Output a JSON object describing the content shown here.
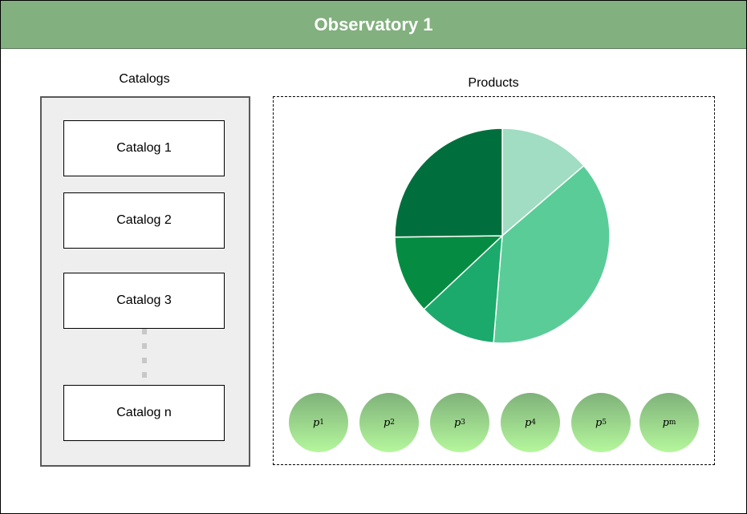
{
  "title": "Observatory 1",
  "colors": {
    "header": "#82b07e",
    "panel_bg": "#eeeeee",
    "product_top": "#7fb27a",
    "product_bottom": "#b5f79c"
  },
  "catalogs": {
    "label": "Catalogs",
    "items": [
      "Catalog 1",
      "Catalog 2",
      "Catalog 3",
      "Catalog n"
    ]
  },
  "products": {
    "label": "Products",
    "chart_data": {
      "type": "pie",
      "slices": [
        {
          "value": 0.137,
          "color": "#a0ddc2"
        },
        {
          "value": 0.376,
          "color": "#5acc98"
        },
        {
          "value": 0.117,
          "color": "#1baa6c"
        },
        {
          "value": 0.118,
          "color": "#068c42"
        },
        {
          "value": 0.252,
          "color": "#016f3d"
        }
      ]
    },
    "items": [
      {
        "symbol": "p",
        "sub": "1"
      },
      {
        "symbol": "p",
        "sub": "2"
      },
      {
        "symbol": "p",
        "sub": "3"
      },
      {
        "symbol": "p",
        "sub": "4"
      },
      {
        "symbol": "p",
        "sub": "5"
      },
      {
        "symbol": "p",
        "sub": "m"
      }
    ]
  }
}
